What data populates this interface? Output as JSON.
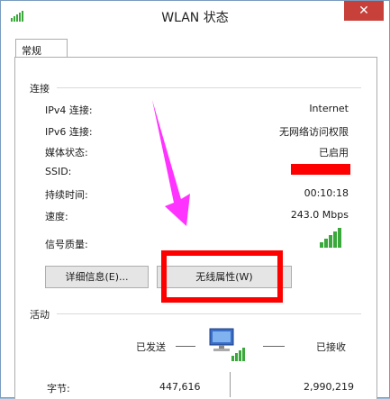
{
  "window": {
    "title": "WLAN 状态",
    "close_glyph": "✕"
  },
  "tabs": [
    {
      "label": "常规"
    }
  ],
  "connection": {
    "group_label": "连接",
    "rows": [
      {
        "label": "IPv4 连接:",
        "value": "Internet"
      },
      {
        "label": "IPv6 连接:",
        "value": "无网络访问权限"
      },
      {
        "label": "媒体状态:",
        "value": "已启用"
      },
      {
        "label": "SSID:",
        "value": ""
      },
      {
        "label": "持续时间:",
        "value": "00:10:18"
      },
      {
        "label": "速度:",
        "value": "243.0 Mbps"
      }
    ],
    "signal_label": "信号质量:",
    "signal_level": 5,
    "signal_max": 5
  },
  "buttons": {
    "details": "详细信息(E)...",
    "wireless_props": "无线属性(W)"
  },
  "activity": {
    "group_label": "活动",
    "sent_label": "已发送",
    "received_label": "已接收",
    "bytes_label": "字节:",
    "bytes_sent": "447,616",
    "bytes_received": "2,990,219"
  },
  "colors": {
    "annotation_box": "#ff0000",
    "annotation_arrow": "#ff33ff",
    "signal": "#3aa83a",
    "close_button": "#c7403a"
  }
}
